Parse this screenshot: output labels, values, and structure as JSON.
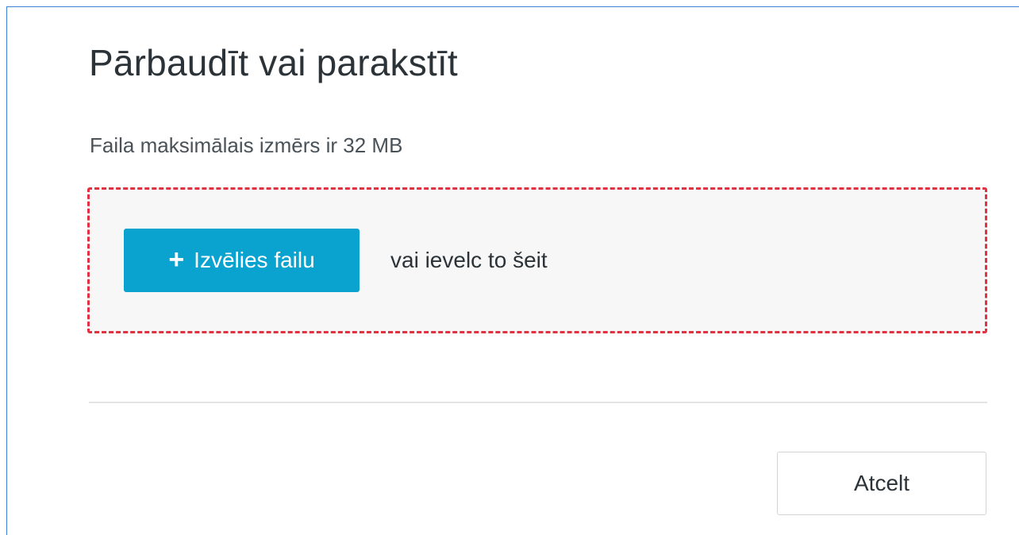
{
  "dialog": {
    "title": "Pārbaudīt vai parakstīt",
    "max_size_text": "Faila maksimālais izmērs ir 32 MB"
  },
  "dropzone": {
    "choose_button_icon": "plus-icon",
    "choose_button_label": "Izvēlies failu",
    "drop_hint": "vai ievelc to šeit"
  },
  "footer": {
    "cancel_label": "Atcelt"
  },
  "colors": {
    "primary_button": "#0aa2cf",
    "dropzone_highlight_border": "#e0323f",
    "window_frame": "#3b82d6",
    "dropzone_background": "#f7f7f7"
  }
}
